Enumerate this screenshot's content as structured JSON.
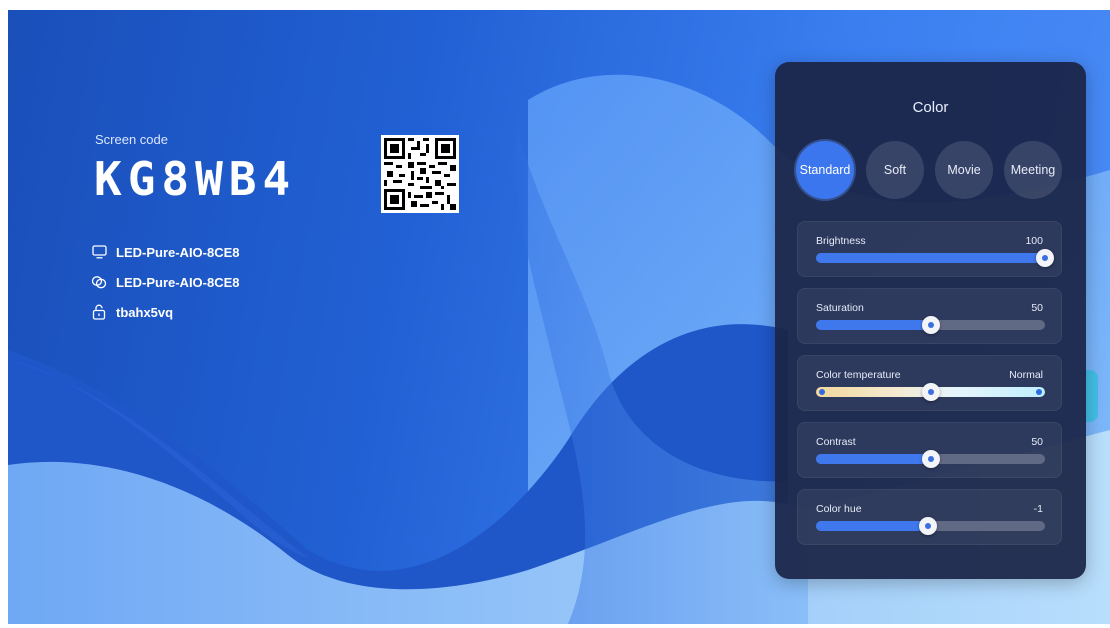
{
  "screen": {
    "code_label": "Screen code",
    "code": "KG8WB4",
    "device_name": "LED-Pure-AIO-8CE8",
    "network_name": "LED-Pure-AIO-8CE8",
    "password": "tbahx5vq",
    "icons": [
      "monitor-icon",
      "link-icon",
      "lock-icon",
      "qr-code"
    ]
  },
  "panel": {
    "title": "Color",
    "modes": [
      {
        "label": "Standard",
        "active": true
      },
      {
        "label": "Soft",
        "active": false
      },
      {
        "label": "Movie",
        "active": false
      },
      {
        "label": "Meeting",
        "active": false
      }
    ],
    "sliders": [
      {
        "label": "Brightness",
        "value": "100",
        "fraction": 1.0
      },
      {
        "label": "Saturation",
        "value": "50",
        "fraction": 0.5
      },
      {
        "label": "Color temperature",
        "value": "Normal",
        "fraction": 0.5
      },
      {
        "label": "Contrast",
        "value": "50",
        "fraction": 0.5
      },
      {
        "label": "Color hue",
        "value": "-1",
        "fraction": 0.49
      }
    ]
  },
  "colors": {
    "accent": "#3c76ee",
    "panel_bg": "#1a2446",
    "background": "#2160d4"
  }
}
